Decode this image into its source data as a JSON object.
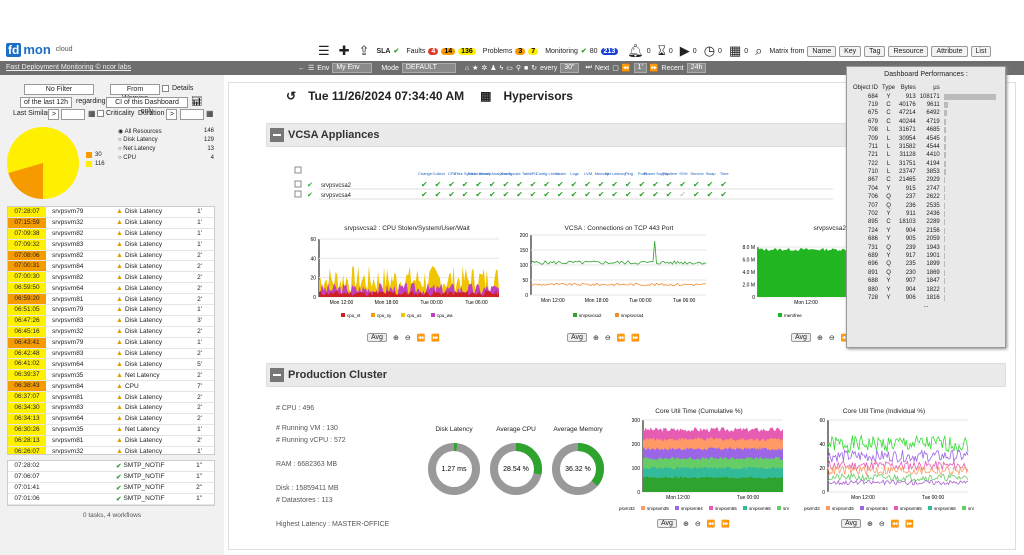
{
  "app": {
    "logo_fd": "fd",
    "logo_mon": "mon",
    "logo_cloud": "cloud",
    "subtitle": "Fast Deployment Monitoring © ncor labs"
  },
  "toolbar": {
    "sla": "SLA",
    "faults": "Faults",
    "fault_counts": [
      "4",
      "14",
      "136"
    ],
    "problems": "Problems",
    "problem_counts": [
      "3",
      "7"
    ],
    "monitoring": "Monitoring",
    "mon_pct": "80",
    "mon_count": "213",
    "bell_count": "0",
    "hour_count": "0",
    "play_count": "0",
    "clock_count": "0",
    "cal_count": "0",
    "matrix": "Matrix from",
    "buttons": [
      "Name",
      "Key",
      "Tag",
      "Resource",
      "Attribute",
      "List"
    ]
  },
  "graybar": {
    "env_label": "Env",
    "env_value": "My Env",
    "mode_label": "Mode",
    "mode_value": "DEFAULT",
    "every": "every",
    "every_value": "30\"",
    "next": "Next",
    "step": "1'",
    "recent": "Recent",
    "recent_value": "24h"
  },
  "filters": {
    "no_filter": "No Filter",
    "from_warning": "From Warning",
    "details": "Details",
    "last": "of the last 12h",
    "regarding": "regarding",
    "ci": "CI of this Dashboard only",
    "last_similar": "Last Similar",
    "gt": ">",
    "criticality": "Criticality",
    "duration": "Duration",
    "dgt": ">"
  },
  "pie": {
    "major": "116",
    "minor": "30",
    "colors": {
      "major": "#ffef00",
      "minor": "#f59b00"
    }
  },
  "resources": [
    {
      "label": "All Resources",
      "count": "146"
    },
    {
      "label": "Disk Latency",
      "count": "129"
    },
    {
      "label": "Net Latency",
      "count": "13"
    },
    {
      "label": "CPU",
      "count": "4"
    }
  ],
  "alerts": [
    {
      "t": "07:28:07",
      "s": "srvpsvm79",
      "m": "Disk Latency",
      "c": "1'",
      "col": "#ffef00"
    },
    {
      "t": "07:15:59",
      "s": "srvpsvm32",
      "m": "Disk Latency",
      "c": "1'",
      "col": "#f59b00"
    },
    {
      "t": "07:09:38",
      "s": "srvpsvm82",
      "m": "Disk Latency",
      "c": "1'",
      "col": "#ffef00"
    },
    {
      "t": "07:09:32",
      "s": "srvpsvm83",
      "m": "Disk Latency",
      "c": "1'",
      "col": "#ffef00"
    },
    {
      "t": "07:08:06",
      "s": "srvpsvm82",
      "m": "Disk Latency",
      "c": "2'",
      "col": "#f59b00"
    },
    {
      "t": "07:00:31",
      "s": "srvpsvm84",
      "m": "Disk Latency",
      "c": "2'",
      "col": "#f59b00"
    },
    {
      "t": "07:00:30",
      "s": "srvpsvm82",
      "m": "Disk Latency",
      "c": "2'",
      "col": "#ffef00"
    },
    {
      "t": "06:59:50",
      "s": "srvpsvm64",
      "m": "Disk Latency",
      "c": "2'",
      "col": "#ffef00"
    },
    {
      "t": "06:59:20",
      "s": "srvpsvm81",
      "m": "Disk Latency",
      "c": "2'",
      "col": "#f59b00"
    },
    {
      "t": "06:51:05",
      "s": "srvpsvm79",
      "m": "Disk Latency",
      "c": "1'",
      "col": "#ffef00"
    },
    {
      "t": "06:47:26",
      "s": "srvpsvm83",
      "m": "Disk Latency",
      "c": "3'",
      "col": "#ffef00"
    },
    {
      "t": "06:45:16",
      "s": "srvpsvm32",
      "m": "Disk Latency",
      "c": "2'",
      "col": "#ffef00"
    },
    {
      "t": "06:43:41",
      "s": "srvpsvm79",
      "m": "Disk Latency",
      "c": "1'",
      "col": "#f59b00"
    },
    {
      "t": "06:42:48",
      "s": "srvpsvm83",
      "m": "Disk Latency",
      "c": "2'",
      "col": "#ffef00"
    },
    {
      "t": "06:41:02",
      "s": "srvpsvm64",
      "m": "Disk Latency",
      "c": "5'",
      "col": "#ffef00"
    },
    {
      "t": "06:39:37",
      "s": "srvpsvm35",
      "m": "Net Latency",
      "c": "2'",
      "col": "#ffef00"
    },
    {
      "t": "06:38:43",
      "s": "srvpsvm84",
      "m": "CPU",
      "c": "7'",
      "col": "#f59b00"
    },
    {
      "t": "06:37:07",
      "s": "srvpsvm81",
      "m": "Disk Latency",
      "c": "2'",
      "col": "#ffef00"
    },
    {
      "t": "06:34:30",
      "s": "srvpsvm83",
      "m": "Disk Latency",
      "c": "2'",
      "col": "#ffef00"
    },
    {
      "t": "06:34:13",
      "s": "srvpsvm64",
      "m": "Disk Latency",
      "c": "2'",
      "col": "#ffef00"
    },
    {
      "t": "06:30:26",
      "s": "srvpsvm35",
      "m": "Net Latency",
      "c": "1'",
      "col": "#ffef00"
    },
    {
      "t": "06:28:13",
      "s": "srvpsvm81",
      "m": "Disk Latency",
      "c": "2'",
      "col": "#ffef00"
    },
    {
      "t": "06:26:07",
      "s": "srvpsvm32",
      "m": "Disk Latency",
      "c": "1'",
      "col": "#ffef00"
    }
  ],
  "notifs": [
    {
      "t": "07:28:02",
      "m": "SMTP_NOTIF",
      "c": "1\""
    },
    {
      "t": "07:06:07",
      "m": "SMTP_NOTIF",
      "c": "1\""
    },
    {
      "t": "07:01:41",
      "m": "SMTP_NOTIF",
      "c": "2\""
    },
    {
      "t": "07:01:06",
      "m": "SMTP_NOTIF",
      "c": "1\""
    }
  ],
  "tasks": "0 tasks, 4 workflows",
  "main": {
    "date": "Tue 11/26/2024 07:34:40 AM",
    "view": "Hypervisors"
  },
  "vcsa": {
    "title": "VCSA Appliances",
    "cols": [
      "Change",
      "Collect",
      "CPU",
      "Files System",
      "Disk Latency",
      "Kernel Analytics",
      "Config",
      "Invoke Table",
      "IPC",
      "Config Limits",
      "Listen",
      "Logs",
      "LVM",
      "Memory",
      "Net Latency",
      "Ping",
      "Ports",
      "Power Supply",
      "Problem",
      "SSH",
      "Service",
      "Swap",
      "Time"
    ],
    "rows": [
      "srvpsvcsa2",
      "srvpsvcsa4"
    ]
  },
  "charts": {
    "c1": {
      "title": "srvpsvcsa2 : CPU Stolen/System/User/Wait",
      "y": [
        "60",
        "40",
        "20",
        "0"
      ],
      "x": [
        "Mon 12:00",
        "Mon 18:00",
        "Tue 00:00",
        "Tue 06:00"
      ],
      "legend": [
        "cpu_st",
        "cpu_sy",
        "cpu_us",
        "cpu_wa"
      ]
    },
    "c2": {
      "title": "VCSA : Connections on TCP 443 Port",
      "y": [
        "200",
        "150",
        "100",
        "50",
        "0"
      ],
      "x": [
        "Mon 12:00",
        "Mon 18:00",
        "Tue 00:00",
        "Tue 06:00"
      ],
      "legend": [
        "srvpsvcsa2",
        "srvpsvcsa4"
      ]
    },
    "c3": {
      "title": "srvpsvcsa2 : me",
      "y": [
        "8.0 M",
        "6.0 M",
        "4.0 M",
        "2.0 M",
        "0"
      ],
      "x": [
        "Mon 12:00"
      ],
      "legend": [
        "memfree"
      ]
    },
    "c4": {
      "title": "Core Util Time (Cumulative %)",
      "y": [
        "300",
        "200",
        "100",
        "0"
      ],
      "x": [
        "Mon 12:00",
        "Tue 00:00"
      ],
      "legend": [
        "srvpsvm32",
        "srvpsvm35",
        "srvpsvm64",
        "srvpsvm65",
        "srvpsvm66",
        "srvpsvm79"
      ]
    },
    "c5": {
      "title": "Core Util Time (Individual %)",
      "y": [
        "60",
        "40",
        "20",
        "0"
      ],
      "x": [
        "Mon 12:00",
        "Tue 00:00"
      ],
      "legend": [
        "srvpsvm32",
        "srvpsvm35",
        "srvpsvm64",
        "srvpsvm65",
        "srvpsvm66",
        "srvpsvm79"
      ]
    },
    "avg": "Avg"
  },
  "prod": {
    "title": "Production Cluster",
    "cpu": "# CPU : 496",
    "vm": "# Running VM : 130",
    "vcpu": "# Running vCPU : 572",
    "ram": "RAM : 6682363 MB",
    "disk": "Disk : 15859411 MB",
    "ds": "# Datastores : 113",
    "hl": "Highest Latency : MASTER-OFFICE",
    "donuts": [
      {
        "label": "Disk Latency",
        "value": "1.27 ms",
        "pct": 0.02
      },
      {
        "label": "Average CPU",
        "value": "28.54 %",
        "pct": 0.2854
      },
      {
        "label": "Average Memory",
        "value": "36.32 %",
        "pct": 0.3632
      }
    ]
  },
  "perf": {
    "title": "Dashboard Performances :",
    "cols": [
      "Object ID",
      "Type",
      "Bytes",
      "µs"
    ],
    "rows": [
      [
        "684",
        "Y",
        "913",
        "108171"
      ],
      [
        "719",
        "C",
        "40176",
        "9611"
      ],
      [
        "675",
        "C",
        "47214",
        "6492"
      ],
      [
        "679",
        "C",
        "40244",
        "4719"
      ],
      [
        "708",
        "L",
        "31671",
        "4685"
      ],
      [
        "709",
        "L",
        "30954",
        "4545"
      ],
      [
        "711",
        "L",
        "31582",
        "4544"
      ],
      [
        "721",
        "L",
        "31128",
        "4410"
      ],
      [
        "722",
        "L",
        "31751",
        "4194"
      ],
      [
        "710",
        "L",
        "23747",
        "3853"
      ],
      [
        "867",
        "C",
        "21465",
        "2929"
      ],
      [
        "704",
        "Y",
        "915",
        "2747"
      ],
      [
        "706",
        "Q",
        "237",
        "2622"
      ],
      [
        "707",
        "Q",
        "236",
        "2535"
      ],
      [
        "702",
        "Y",
        "911",
        "2436"
      ],
      [
        "895",
        "C",
        "18103",
        "2289"
      ],
      [
        "724",
        "Y",
        "904",
        "2156"
      ],
      [
        "686",
        "Y",
        "905",
        "2059"
      ],
      [
        "731",
        "Q",
        "239",
        "1943"
      ],
      [
        "689",
        "Y",
        "917",
        "1901"
      ],
      [
        "696",
        "Q",
        "235",
        "1899"
      ],
      [
        "891",
        "Q",
        "230",
        "1869"
      ],
      [
        "688",
        "Y",
        "907",
        "1847"
      ],
      [
        "880",
        "Y",
        "904",
        "1822"
      ],
      [
        "728",
        "Y",
        "906",
        "1816"
      ]
    ],
    "more": "..."
  }
}
